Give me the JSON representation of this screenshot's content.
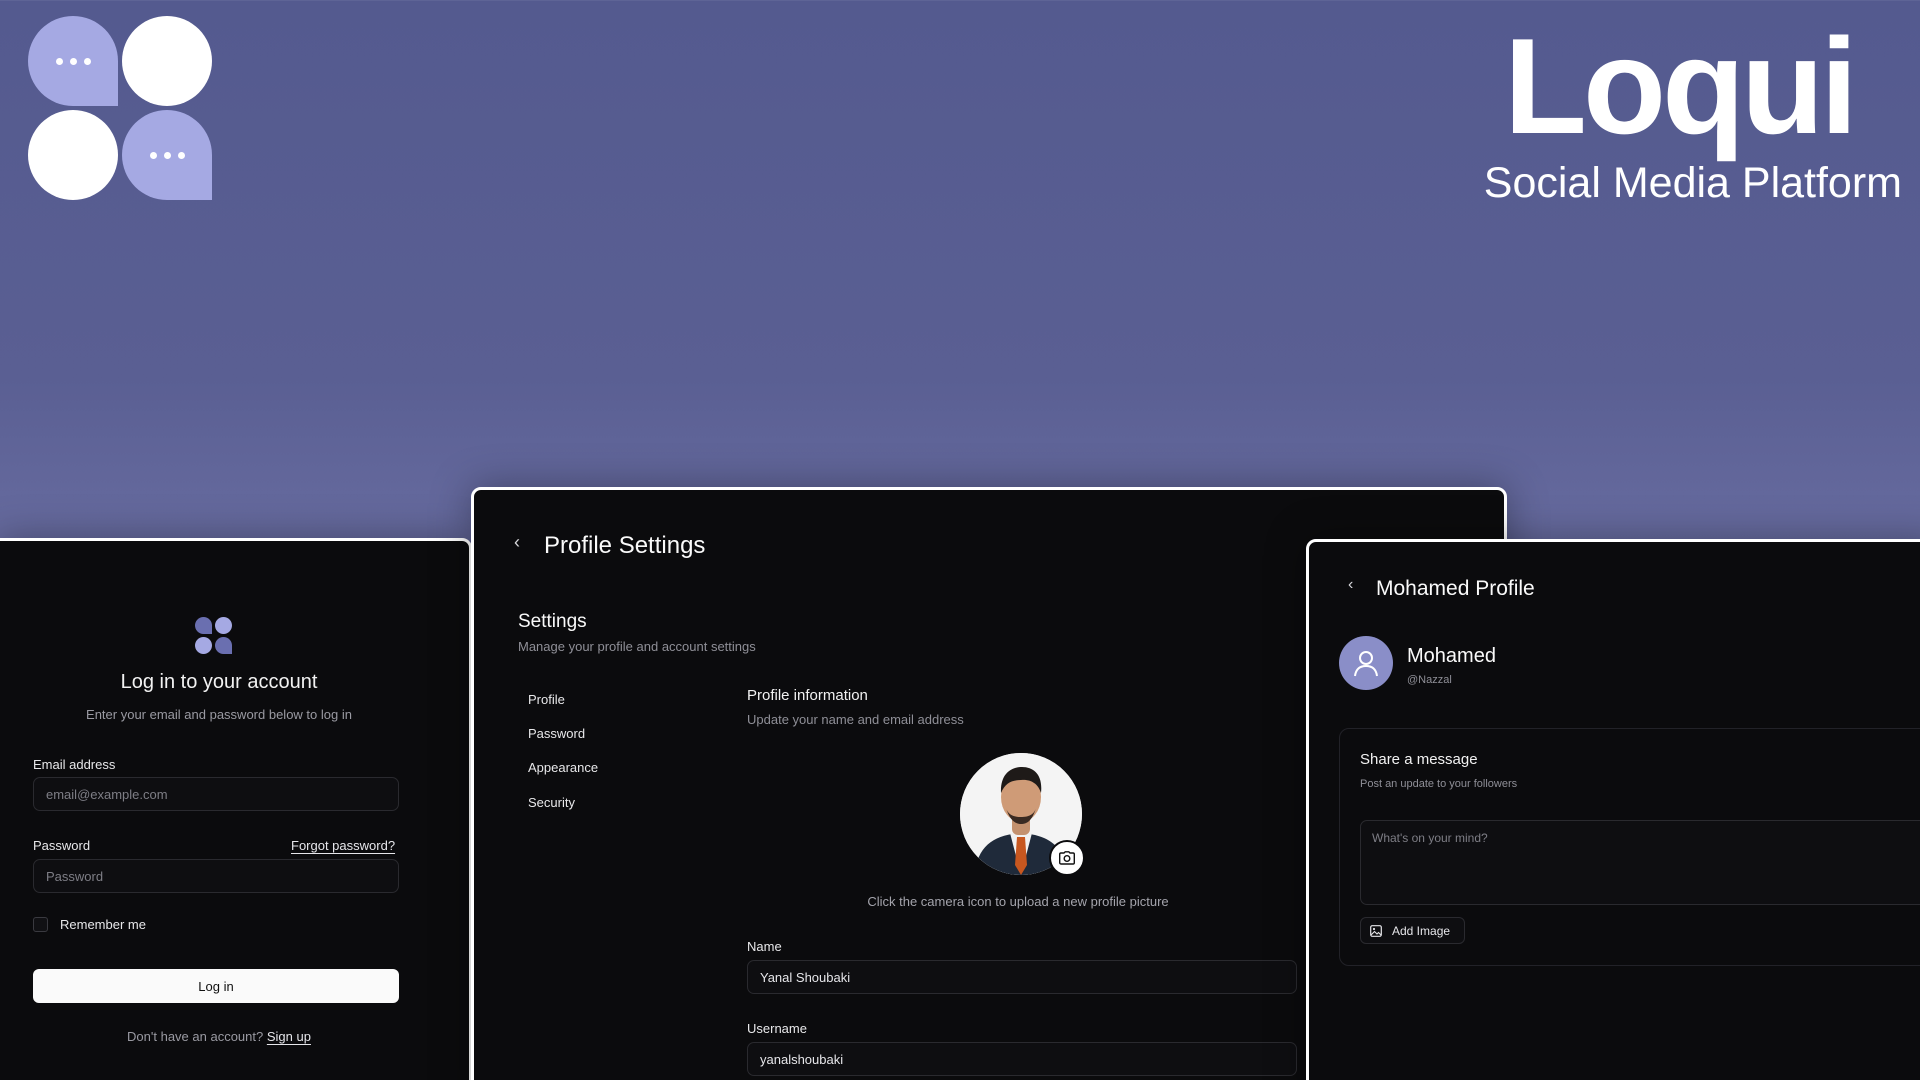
{
  "brand": {
    "name": "Loqui",
    "tagline": "Social Media Platform"
  },
  "colors": {
    "accent": "#a5a9e3",
    "background": "#545a8f",
    "panel": "#0b0b0d"
  },
  "login": {
    "title": "Log in to your account",
    "subtitle": "Enter your email and password below to log in",
    "email_label": "Email address",
    "email_placeholder": "email@example.com",
    "password_label": "Password",
    "forgot_password": "Forgot password?",
    "password_placeholder": "Password",
    "remember_me": "Remember me",
    "login_button": "Log in",
    "no_account": "Don't have an account?",
    "signup": "Sign up"
  },
  "settings": {
    "page_title": "Profile Settings",
    "section_title": "Settings",
    "section_subtitle": "Manage your profile and account settings",
    "nav": [
      {
        "label": "Profile",
        "icon": "none"
      },
      {
        "label": "Password",
        "icon": "none"
      },
      {
        "label": "Appearance",
        "icon": "none"
      },
      {
        "label": "Security",
        "icon": "none"
      }
    ],
    "profile_info_title": "Profile information",
    "profile_info_subtitle": "Update your name and email address",
    "upload_hint": "Click the camera icon to upload a new profile picture",
    "name_label": "Name",
    "name_value": "Yanal Shoubaki",
    "username_label": "Username",
    "username_value": "yanalshoubaki"
  },
  "profile": {
    "page_title": "Mohamed Profile",
    "display_name": "Mohamed",
    "handle": "@Nazzal",
    "share_title": "Share a message",
    "share_subtitle": "Post an update to your followers",
    "textarea_placeholder": "What's on your mind?",
    "add_image": "Add Image"
  }
}
